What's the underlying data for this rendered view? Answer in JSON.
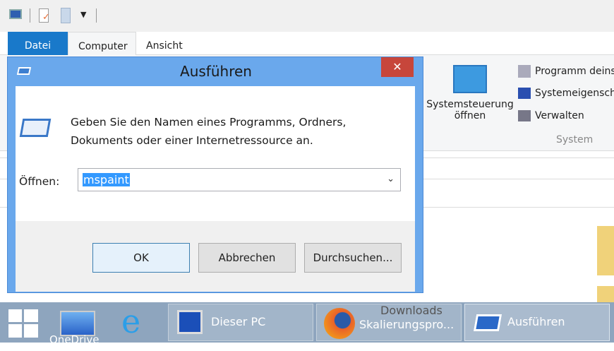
{
  "qat": {
    "icons": [
      "computer-icon",
      "properties-icon",
      "new-folder-icon",
      "customize-dropdown-icon"
    ]
  },
  "tabs": [
    {
      "label": "Datei"
    },
    {
      "label": "Computer"
    },
    {
      "label": "Ansicht"
    }
  ],
  "ribbon": {
    "control_panel": "Systemsteuerung",
    "control_panel2": "öffnen",
    "items": [
      "Programm deins",
      "Systemeigensch",
      "Verwalten"
    ],
    "group": "System"
  },
  "dialog": {
    "title": "Ausführen",
    "close": "✕",
    "message1": "Geben Sie den Namen eines Programms, Ordners,",
    "message2": "Dokuments oder einer Internetressource an.",
    "open_label": "Öffnen:",
    "open_value": "mspaint",
    "ok": "OK",
    "cancel": "Abbrechen",
    "browse": "Durchsuchen..."
  },
  "taskbar": {
    "onedrive": "OneDrive",
    "items": [
      {
        "label": "Dieser PC"
      },
      {
        "label": "Downloads",
        "label2": "Skalierungspro..."
      },
      {
        "label": "Ausführen"
      }
    ]
  }
}
